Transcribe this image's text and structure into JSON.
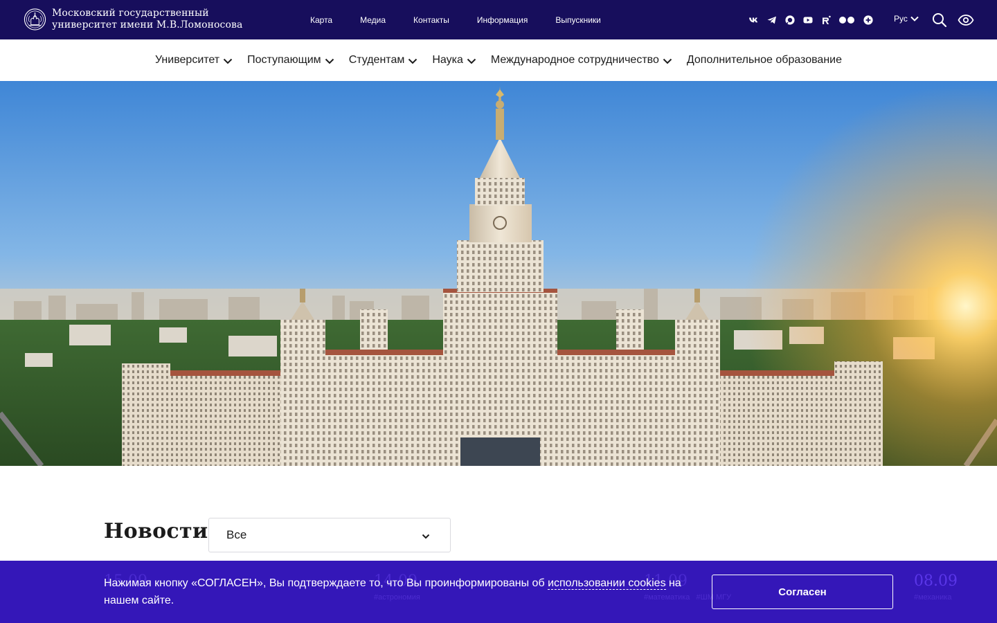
{
  "header": {
    "logo_line1": "Московский государственный",
    "logo_line2": "университет имени М.В.Ломоносова",
    "links": [
      "Карта",
      "Медиа",
      "Контакты",
      "Информация",
      "Выпускники"
    ],
    "socials": [
      "vk-icon",
      "telegram-icon",
      "max-icon",
      "youtube-icon",
      "rutube-icon",
      "flickr-icon",
      "more-icon"
    ],
    "lang": "Рус"
  },
  "nav": {
    "items": [
      {
        "label": "Университет",
        "has_menu": true
      },
      {
        "label": "Поступающим",
        "has_menu": true
      },
      {
        "label": "Студентам",
        "has_menu": true
      },
      {
        "label": "Наука",
        "has_menu": true
      },
      {
        "label": "Международное сотрудничество",
        "has_menu": true
      },
      {
        "label": "Дополнительное образование",
        "has_menu": false
      }
    ]
  },
  "news": {
    "title": "Новости",
    "filter_value": "Все",
    "cards": [
      {
        "date": "15.09",
        "tags": ""
      },
      {
        "date": "14.09",
        "tags": "#астрономия"
      },
      {
        "date": "11.09",
        "tags": "#математика   #ШМ МГУ"
      },
      {
        "date": "08.09",
        "tags": "#механика"
      }
    ]
  },
  "cookie": {
    "text_before": "Нажимая кнопку «СОГЛАСЕН», Вы подтверждаете то, что Вы проинформированы об ",
    "link_text": "использовании cookies",
    "text_after": " на нашем сайте.",
    "button_label": "Согласен"
  },
  "colors": {
    "header_bg": "#170e5c",
    "cookie_bg": "#3417b8",
    "text_dark": "#1b1b1b"
  }
}
